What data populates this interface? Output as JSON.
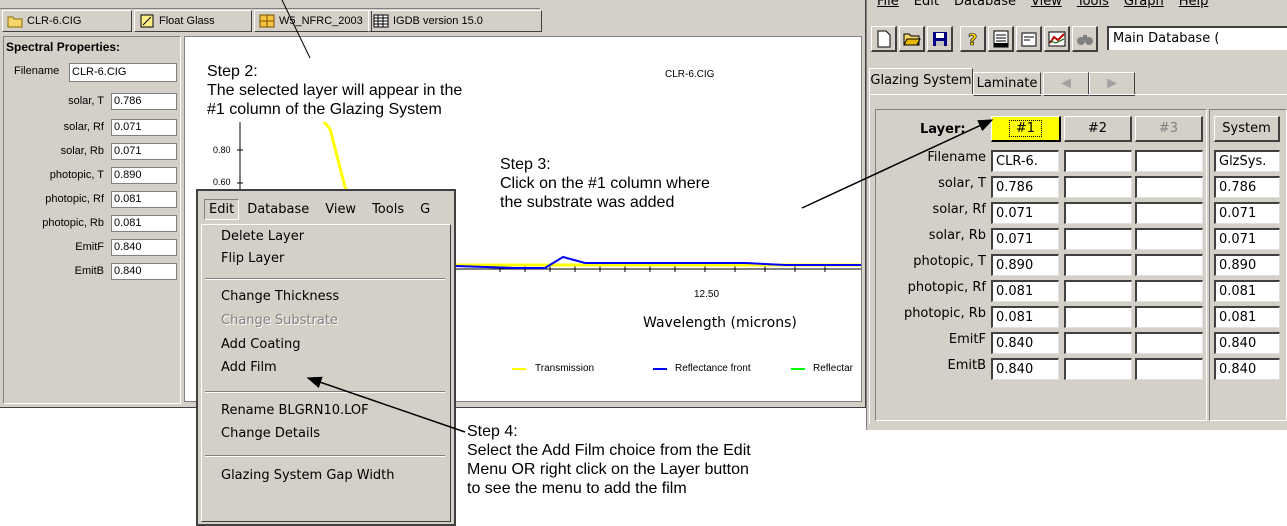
{
  "left_window": {
    "tabs": [
      {
        "label": "CLR-6.CIG",
        "icon": "folder-icon"
      },
      {
        "label": "Float Glass",
        "icon": "glass-icon"
      },
      {
        "label": "W5_NFRC_2003",
        "icon": "window-icon"
      },
      {
        "label": "IGDB version 15.0",
        "icon": "database-icon"
      }
    ],
    "spectral": {
      "title": "Spectral Properties:",
      "filename_label": "Filename",
      "filename_value": "CLR-6.CIG",
      "rows": [
        {
          "label": "solar, T",
          "value": "0.786"
        },
        {
          "label": "solar, Rf",
          "value": "0.071"
        },
        {
          "label": "solar, Rb",
          "value": "0.071"
        },
        {
          "label": "photopic, T",
          "value": "0.890"
        },
        {
          "label": "photopic, Rf",
          "value": "0.081"
        },
        {
          "label": "photopic, Rb",
          "value": "0.081"
        },
        {
          "label": "EmitF",
          "value": "0.840"
        },
        {
          "label": "EmitB",
          "value": "0.840"
        }
      ]
    },
    "chart": {
      "title": "CLR-6.CIG",
      "yticks": [
        "0.80",
        "0.60"
      ],
      "xtick": "12.50",
      "xlabel": "Wavelength (microns)",
      "legend": [
        {
          "label": "Transmission",
          "color": "#ffff00"
        },
        {
          "label": "Reflectance front",
          "color": "#0000ff"
        },
        {
          "label": "Reflectar",
          "color": "#00ff00"
        }
      ]
    }
  },
  "context_menu": {
    "menubar": [
      "Edit",
      "Database",
      "View",
      "Tools",
      "G"
    ],
    "group1": [
      {
        "label": "Delete Layer",
        "enabled": true
      },
      {
        "label": "Flip Layer",
        "enabled": true
      }
    ],
    "group2": [
      {
        "label": "Change Thickness",
        "enabled": true
      },
      {
        "label": "Change Substrate",
        "enabled": false
      },
      {
        "label": "Add Coating",
        "enabled": true
      },
      {
        "label": "Add Film",
        "enabled": true
      }
    ],
    "group3": [
      {
        "label": "Rename BLGRN10.LOF",
        "enabled": true
      },
      {
        "label": "Change Details",
        "enabled": true
      }
    ],
    "group4": [
      {
        "label": "Glazing System Gap Width",
        "enabled": true
      }
    ]
  },
  "right_window": {
    "menubar": [
      "File",
      "Edit",
      "Database",
      "View",
      "Tools",
      "Graph",
      "Help"
    ],
    "toolbar_icons": [
      "new-file-icon",
      "open-folder-icon",
      "save-icon",
      "help-icon",
      "report-icon",
      "edit-icon",
      "chart-icon",
      "binoculars-icon"
    ],
    "database_select": "Main Database (",
    "tabs": [
      "Glazing System",
      "Laminate"
    ],
    "layer_header": "Layer:",
    "columns": [
      "#1",
      "#2",
      "#3"
    ],
    "system_label": "System",
    "rows": [
      {
        "label": "Filename",
        "c1": "CLR-6.",
        "sys": "GlzSys."
      },
      {
        "label": "solar, T",
        "c1": "0.786",
        "sys": "0.786"
      },
      {
        "label": "solar, Rf",
        "c1": "0.071",
        "sys": "0.071"
      },
      {
        "label": "solar, Rb",
        "c1": "0.071",
        "sys": "0.071"
      },
      {
        "label": "photopic, T",
        "c1": "0.890",
        "sys": "0.890"
      },
      {
        "label": "photopic, Rf",
        "c1": "0.081",
        "sys": "0.081"
      },
      {
        "label": "photopic, Rb",
        "c1": "0.081",
        "sys": "0.081"
      },
      {
        "label": "EmitF",
        "c1": "0.840",
        "sys": "0.840"
      },
      {
        "label": "EmitB",
        "c1": "0.840",
        "sys": "0.840"
      }
    ]
  },
  "annotations": {
    "step2": [
      "Step 2:",
      "The selected layer will appear in the",
      "#1 column of the Glazing System"
    ],
    "step3": [
      "Step 3:",
      "Click on the #1 column where",
      "the substrate was added"
    ],
    "step4": [
      "Step 4:",
      "Select the Add Film choice from the Edit",
      "Menu OR right click on the Layer button",
      "to see the menu to add the film"
    ]
  }
}
